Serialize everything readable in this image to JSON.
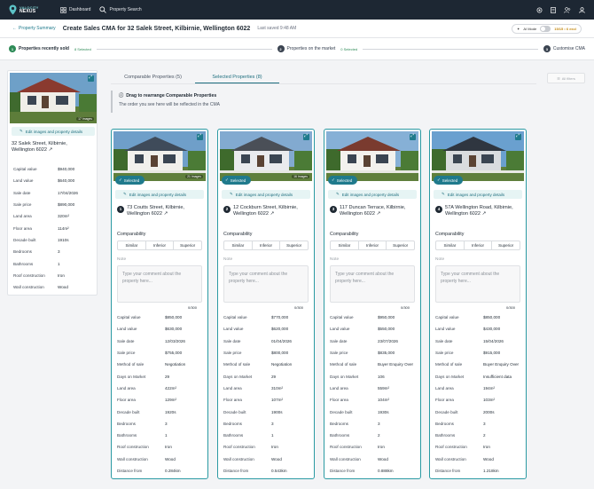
{
  "app": {
    "logo_line1": "VALOCITY",
    "logo_line2": "NEXUS",
    "nav": [
      {
        "label": "Dashboard",
        "icon": "grid-icon"
      },
      {
        "label": "Property Search",
        "icon": "search-icon"
      }
    ]
  },
  "header": {
    "back_label": "Property Summary",
    "title": "Create Sales CMA for 32 Salek Street, Kilbirnie, Wellington 6022",
    "last_saved": "Last saved 9:48 AM",
    "ai_mode_label": "AI Mode",
    "ai_quota": "15/15 • 6 excl"
  },
  "steps": [
    {
      "num": "1",
      "label": "Properties recently sold",
      "selected": "8 Selected"
    },
    {
      "num": "2",
      "label": "Properties on the market",
      "selected": "0 Selected"
    },
    {
      "num": "3",
      "label": "Customise CMA",
      "selected": ""
    }
  ],
  "subject": {
    "image_count": "17 Images",
    "edit_label": "Edit images and property details",
    "address_line1": "32 Salek Street, Kilbirnie,",
    "address_line2": "Wellington 6022",
    "rows": [
      {
        "k": "Capital value",
        "v": "$940,000"
      },
      {
        "k": "Land value",
        "v": "$640,000"
      },
      {
        "k": "Sale date",
        "v": "17/04/2026"
      },
      {
        "k": "Sale price",
        "v": "$890,000"
      },
      {
        "k": "Land area",
        "v": "320m²"
      },
      {
        "k": "Floor area",
        "v": "114m²"
      },
      {
        "k": "Decade built",
        "v": "1910s"
      },
      {
        "k": "Bedrooms",
        "v": "3"
      },
      {
        "k": "Bathrooms",
        "v": "1"
      },
      {
        "k": "Roof construction",
        "v": "Iron"
      },
      {
        "k": "Wall construction",
        "v": "Wood"
      }
    ]
  },
  "tabs": [
    {
      "label": "Comparable Properties (5)"
    },
    {
      "label": "Selected Properties (8)"
    }
  ],
  "filters_label": "All filters",
  "notice": {
    "heading": "Drag to rearrange Comparable Properties",
    "text": "The order you see here will be reflected in the CMA"
  },
  "card_common": {
    "selected_label": "Selected",
    "edit_label": "Edit images and property details",
    "comparability_label": "Comparability",
    "options": [
      "Similar",
      "Inferior",
      "Superior"
    ],
    "note_label": "Note",
    "note_placeholder": "Type your comment about the property here...",
    "counter": "0/300"
  },
  "cards": [
    {
      "num": "1",
      "image_count": "21 Images",
      "address_line1": "73 Coutts Street, Kilbirnie,",
      "address_line2": "Wellington 6022",
      "rows": [
        {
          "k": "Capital value",
          "v": "$850,000"
        },
        {
          "k": "Land value",
          "v": "$630,000"
        },
        {
          "k": "Sale date",
          "v": "12/03/2026"
        },
        {
          "k": "Sale price",
          "v": "$755,000"
        },
        {
          "k": "Method of sale",
          "v": "Negotiation"
        },
        {
          "k": "Days on Market",
          "v": "29"
        },
        {
          "k": "Land area",
          "v": "422m²"
        },
        {
          "k": "Floor area",
          "v": "129m²"
        },
        {
          "k": "Decade built",
          "v": "1920s"
        },
        {
          "k": "Bedrooms",
          "v": "3"
        },
        {
          "k": "Bathrooms",
          "v": "1"
        },
        {
          "k": "Roof construction",
          "v": "Iron"
        },
        {
          "k": "Wall construction",
          "v": "Wood"
        },
        {
          "k": "Distance from",
          "v": "0.284km"
        }
      ]
    },
    {
      "num": "2",
      "image_count": "16 Images",
      "address_line1": "12 Cockburn Street, Kilbirnie,",
      "address_line2": "Wellington 6022",
      "rows": [
        {
          "k": "Capital value",
          "v": "$770,000"
        },
        {
          "k": "Land value",
          "v": "$620,000"
        },
        {
          "k": "Sale date",
          "v": "01/04/2026"
        },
        {
          "k": "Sale price",
          "v": "$800,000"
        },
        {
          "k": "Method of sale",
          "v": "Negotiation"
        },
        {
          "k": "Days on Market",
          "v": "29"
        },
        {
          "k": "Land area",
          "v": "310m²"
        },
        {
          "k": "Floor area",
          "v": "107m²"
        },
        {
          "k": "Decade built",
          "v": "1900s"
        },
        {
          "k": "Bedrooms",
          "v": "3"
        },
        {
          "k": "Bathrooms",
          "v": "1"
        },
        {
          "k": "Roof construction",
          "v": "Iron"
        },
        {
          "k": "Wall construction",
          "v": "Wood"
        },
        {
          "k": "Distance from",
          "v": "0.543km"
        }
      ]
    },
    {
      "num": "3",
      "image_count": "",
      "address_line1": "117 Duncan Terrace, Kilbirnie,",
      "address_line2": "Wellington 6022",
      "rows": [
        {
          "k": "Capital value",
          "v": "$950,000"
        },
        {
          "k": "Land value",
          "v": "$550,000"
        },
        {
          "k": "Sale date",
          "v": "23/07/2026"
        },
        {
          "k": "Sale price",
          "v": "$835,000"
        },
        {
          "k": "Method of sale",
          "v": "Buyer Enquiry Over"
        },
        {
          "k": "Days on Market",
          "v": "106"
        },
        {
          "k": "Land area",
          "v": "559m²"
        },
        {
          "k": "Floor area",
          "v": "104m²"
        },
        {
          "k": "Decade built",
          "v": "1930s"
        },
        {
          "k": "Bedrooms",
          "v": "3"
        },
        {
          "k": "Bathrooms",
          "v": "2"
        },
        {
          "k": "Roof construction",
          "v": "Iron"
        },
        {
          "k": "Wall construction",
          "v": "Wood"
        },
        {
          "k": "Distance from",
          "v": "0.888km"
        }
      ]
    },
    {
      "num": "4",
      "image_count": "",
      "address_line1": "57A Wellington Road, Kilbirnie,",
      "address_line2": "Wellington 6022",
      "rows": [
        {
          "k": "Capital value",
          "v": "$850,000"
        },
        {
          "k": "Land value",
          "v": "$430,000"
        },
        {
          "k": "Sale date",
          "v": "15/04/2026"
        },
        {
          "k": "Sale price",
          "v": "$915,000"
        },
        {
          "k": "Method of sale",
          "v": "Buyer Enquiry Over"
        },
        {
          "k": "Days on Market",
          "v": "Insufficient data"
        },
        {
          "k": "Land area",
          "v": "194m²"
        },
        {
          "k": "Floor area",
          "v": "103m²"
        },
        {
          "k": "Decade built",
          "v": "2000s"
        },
        {
          "k": "Bedrooms",
          "v": "3"
        },
        {
          "k": "Bathrooms",
          "v": "2"
        },
        {
          "k": "Roof construction",
          "v": "Iron"
        },
        {
          "k": "Wall construction",
          "v": "Wood"
        },
        {
          "k": "Distance from",
          "v": "1.218km"
        }
      ]
    }
  ]
}
